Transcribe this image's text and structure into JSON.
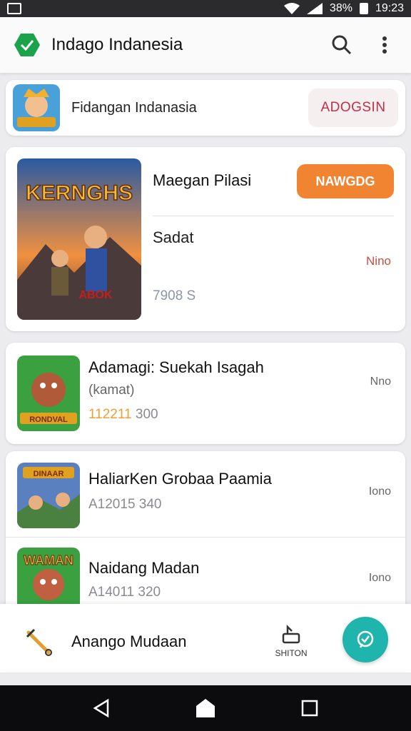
{
  "status_bar": {
    "battery": "38%",
    "time": "19:23"
  },
  "app_bar": {
    "title": "Indago Indanesia"
  },
  "banner": {
    "text": "Fidangan Indanasia",
    "button_label": "ADOGSIN"
  },
  "featured": {
    "title": "Maegan Pilasi",
    "button_label": "NAWGDG",
    "subtitle": "Sadat",
    "right_label": "Nino",
    "count": "7908 S",
    "art_text": "KERNGHS",
    "art_badge": "ABOK"
  },
  "apps": [
    {
      "title": "Adamagi: Suekah Isagah",
      "subtitle": "(kamat)",
      "stat_highlight": "112211",
      "stat_value": "300",
      "right_label": "Nno",
      "art_text": "RONDVAL"
    },
    {
      "title": "HaliarKen Grobaa Paamia",
      "stat_value": "A12015 340",
      "right_label": "Iono",
      "art_text": "DINAAR"
    },
    {
      "title": "Naidang Madan",
      "stat_value": "A14011 320",
      "right_label": "Iono",
      "art_text": "WAMAN"
    }
  ],
  "bottom_bar": {
    "label": "Anango Mudaan",
    "tab_label": "SHITON"
  },
  "colors": {
    "accent_orange": "#f08430",
    "fab_teal": "#1fb5ad",
    "login_red": "#c0304a",
    "logo_green": "#1aa34a"
  },
  "icons": [
    "logo-icon",
    "search-icon",
    "more-vert-icon",
    "tool-icon",
    "tab-icon",
    "chat-icon",
    "back-icon",
    "home-icon",
    "recents-icon"
  ]
}
